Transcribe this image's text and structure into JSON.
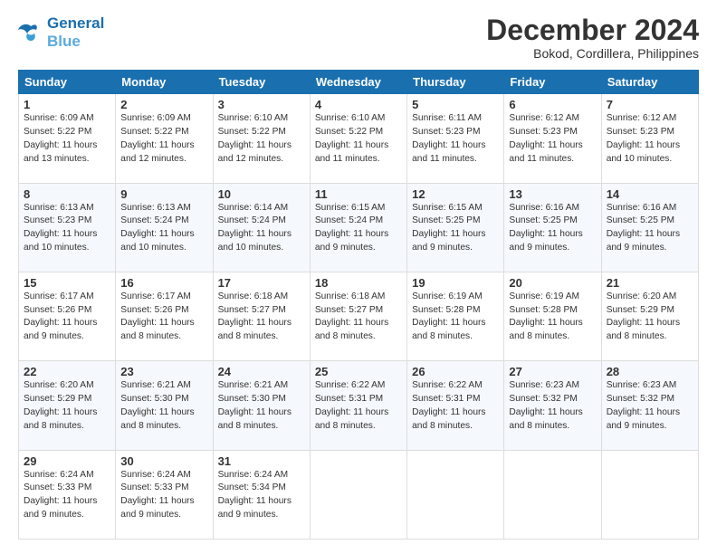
{
  "logo": {
    "line1": "General",
    "line2": "Blue"
  },
  "title": "December 2024",
  "subtitle": "Bokod, Cordillera, Philippines",
  "days_of_week": [
    "Sunday",
    "Monday",
    "Tuesday",
    "Wednesday",
    "Thursday",
    "Friday",
    "Saturday"
  ],
  "weeks": [
    [
      {
        "day": "1",
        "sunrise": "Sunrise: 6:09 AM",
        "sunset": "Sunset: 5:22 PM",
        "daylight": "Daylight: 11 hours and 13 minutes."
      },
      {
        "day": "2",
        "sunrise": "Sunrise: 6:09 AM",
        "sunset": "Sunset: 5:22 PM",
        "daylight": "Daylight: 11 hours and 12 minutes."
      },
      {
        "day": "3",
        "sunrise": "Sunrise: 6:10 AM",
        "sunset": "Sunset: 5:22 PM",
        "daylight": "Daylight: 11 hours and 12 minutes."
      },
      {
        "day": "4",
        "sunrise": "Sunrise: 6:10 AM",
        "sunset": "Sunset: 5:22 PM",
        "daylight": "Daylight: 11 hours and 11 minutes."
      },
      {
        "day": "5",
        "sunrise": "Sunrise: 6:11 AM",
        "sunset": "Sunset: 5:23 PM",
        "daylight": "Daylight: 11 hours and 11 minutes."
      },
      {
        "day": "6",
        "sunrise": "Sunrise: 6:12 AM",
        "sunset": "Sunset: 5:23 PM",
        "daylight": "Daylight: 11 hours and 11 minutes."
      },
      {
        "day": "7",
        "sunrise": "Sunrise: 6:12 AM",
        "sunset": "Sunset: 5:23 PM",
        "daylight": "Daylight: 11 hours and 10 minutes."
      }
    ],
    [
      {
        "day": "8",
        "sunrise": "Sunrise: 6:13 AM",
        "sunset": "Sunset: 5:23 PM",
        "daylight": "Daylight: 11 hours and 10 minutes."
      },
      {
        "day": "9",
        "sunrise": "Sunrise: 6:13 AM",
        "sunset": "Sunset: 5:24 PM",
        "daylight": "Daylight: 11 hours and 10 minutes."
      },
      {
        "day": "10",
        "sunrise": "Sunrise: 6:14 AM",
        "sunset": "Sunset: 5:24 PM",
        "daylight": "Daylight: 11 hours and 10 minutes."
      },
      {
        "day": "11",
        "sunrise": "Sunrise: 6:15 AM",
        "sunset": "Sunset: 5:24 PM",
        "daylight": "Daylight: 11 hours and 9 minutes."
      },
      {
        "day": "12",
        "sunrise": "Sunrise: 6:15 AM",
        "sunset": "Sunset: 5:25 PM",
        "daylight": "Daylight: 11 hours and 9 minutes."
      },
      {
        "day": "13",
        "sunrise": "Sunrise: 6:16 AM",
        "sunset": "Sunset: 5:25 PM",
        "daylight": "Daylight: 11 hours and 9 minutes."
      },
      {
        "day": "14",
        "sunrise": "Sunrise: 6:16 AM",
        "sunset": "Sunset: 5:25 PM",
        "daylight": "Daylight: 11 hours and 9 minutes."
      }
    ],
    [
      {
        "day": "15",
        "sunrise": "Sunrise: 6:17 AM",
        "sunset": "Sunset: 5:26 PM",
        "daylight": "Daylight: 11 hours and 9 minutes."
      },
      {
        "day": "16",
        "sunrise": "Sunrise: 6:17 AM",
        "sunset": "Sunset: 5:26 PM",
        "daylight": "Daylight: 11 hours and 8 minutes."
      },
      {
        "day": "17",
        "sunrise": "Sunrise: 6:18 AM",
        "sunset": "Sunset: 5:27 PM",
        "daylight": "Daylight: 11 hours and 8 minutes."
      },
      {
        "day": "18",
        "sunrise": "Sunrise: 6:18 AM",
        "sunset": "Sunset: 5:27 PM",
        "daylight": "Daylight: 11 hours and 8 minutes."
      },
      {
        "day": "19",
        "sunrise": "Sunrise: 6:19 AM",
        "sunset": "Sunset: 5:28 PM",
        "daylight": "Daylight: 11 hours and 8 minutes."
      },
      {
        "day": "20",
        "sunrise": "Sunrise: 6:19 AM",
        "sunset": "Sunset: 5:28 PM",
        "daylight": "Daylight: 11 hours and 8 minutes."
      },
      {
        "day": "21",
        "sunrise": "Sunrise: 6:20 AM",
        "sunset": "Sunset: 5:29 PM",
        "daylight": "Daylight: 11 hours and 8 minutes."
      }
    ],
    [
      {
        "day": "22",
        "sunrise": "Sunrise: 6:20 AM",
        "sunset": "Sunset: 5:29 PM",
        "daylight": "Daylight: 11 hours and 8 minutes."
      },
      {
        "day": "23",
        "sunrise": "Sunrise: 6:21 AM",
        "sunset": "Sunset: 5:30 PM",
        "daylight": "Daylight: 11 hours and 8 minutes."
      },
      {
        "day": "24",
        "sunrise": "Sunrise: 6:21 AM",
        "sunset": "Sunset: 5:30 PM",
        "daylight": "Daylight: 11 hours and 8 minutes."
      },
      {
        "day": "25",
        "sunrise": "Sunrise: 6:22 AM",
        "sunset": "Sunset: 5:31 PM",
        "daylight": "Daylight: 11 hours and 8 minutes."
      },
      {
        "day": "26",
        "sunrise": "Sunrise: 6:22 AM",
        "sunset": "Sunset: 5:31 PM",
        "daylight": "Daylight: 11 hours and 8 minutes."
      },
      {
        "day": "27",
        "sunrise": "Sunrise: 6:23 AM",
        "sunset": "Sunset: 5:32 PM",
        "daylight": "Daylight: 11 hours and 8 minutes."
      },
      {
        "day": "28",
        "sunrise": "Sunrise: 6:23 AM",
        "sunset": "Sunset: 5:32 PM",
        "daylight": "Daylight: 11 hours and 9 minutes."
      }
    ],
    [
      {
        "day": "29",
        "sunrise": "Sunrise: 6:24 AM",
        "sunset": "Sunset: 5:33 PM",
        "daylight": "Daylight: 11 hours and 9 minutes."
      },
      {
        "day": "30",
        "sunrise": "Sunrise: 6:24 AM",
        "sunset": "Sunset: 5:33 PM",
        "daylight": "Daylight: 11 hours and 9 minutes."
      },
      {
        "day": "31",
        "sunrise": "Sunrise: 6:24 AM",
        "sunset": "Sunset: 5:34 PM",
        "daylight": "Daylight: 11 hours and 9 minutes."
      },
      null,
      null,
      null,
      null
    ]
  ]
}
